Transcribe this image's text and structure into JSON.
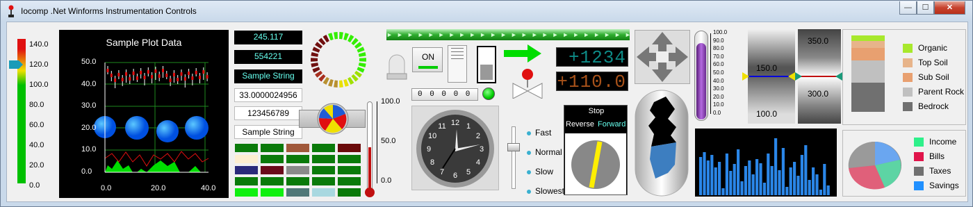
{
  "window": {
    "title": "Iocomp .Net Winforms Instrumentation Controls",
    "min_label": "—",
    "max_label": "☐",
    "close_label": "✕"
  },
  "linear_gauge": {
    "ticks": [
      "140.0",
      "120.0",
      "100.0",
      "80.0",
      "60.0",
      "40.0",
      "20.0",
      "0.0"
    ],
    "pointer_value": 121,
    "max": 150
  },
  "plot": {
    "title": "Sample Plot Data",
    "y_ticks": [
      "50.0",
      "40.0",
      "30.0",
      "20.0",
      "10.0",
      "0.0"
    ],
    "x_ticks": [
      "0.0",
      "20.0",
      "40.0"
    ]
  },
  "displays": {
    "lcd1": "245.117",
    "lcd2": "554221",
    "lcd3": "Sample String",
    "label1": "33.0000024956",
    "label2": "123456789",
    "label3": "Sample String"
  },
  "odometer": "0 0 0 0 0",
  "switch_on_label": "ON",
  "thermometer": {
    "ticks": [
      "100.0",
      "50.0",
      "0.0"
    ]
  },
  "seven_seg": {
    "top": "+1234",
    "bottom": "+110.0"
  },
  "clock": {
    "numbers": [
      "12",
      "1",
      "2",
      "3",
      "4",
      "5",
      "6",
      "7",
      "8",
      "9",
      "10",
      "11"
    ]
  },
  "slider_switch": {
    "options": [
      "Fast",
      "Normal",
      "Slow",
      "Slowest"
    ],
    "selected": "Normal"
  },
  "rotary": {
    "stop_label": "Stop",
    "reverse_label": "Reverse",
    "forward_label": "Forward"
  },
  "tube": {
    "ticks": [
      "100.0",
      "90.0",
      "80.0",
      "70.0",
      "60.0",
      "50.0",
      "40.0",
      "30.0",
      "20.0",
      "10.0",
      "0.0"
    ]
  },
  "scale1": {
    "value": "150.0",
    "lower": "100.0"
  },
  "scale2": {
    "upper": "350.0",
    "lower": "300.0"
  },
  "soil_legend": [
    {
      "label": "Organic",
      "color": "#a8e82c"
    },
    {
      "label": "Top Soil",
      "color": "#e7b48a"
    },
    {
      "label": "Sub Soil",
      "color": "#e8a070"
    },
    {
      "label": "Parent Rock",
      "color": "#c0c0c0"
    },
    {
      "label": "Bedrock",
      "color": "#707070"
    }
  ],
  "pie_legend": [
    {
      "label": "Income",
      "color": "#2ef08a"
    },
    {
      "label": "Bills",
      "color": "#e0144a"
    },
    {
      "label": "Taxes",
      "color": "#707070"
    },
    {
      "label": "Savings",
      "color": "#2090ff"
    }
  ],
  "colors": {
    "accent_green": "#00cc00",
    "lcd_text": "#66eedd",
    "plot_bg": "#000000"
  }
}
